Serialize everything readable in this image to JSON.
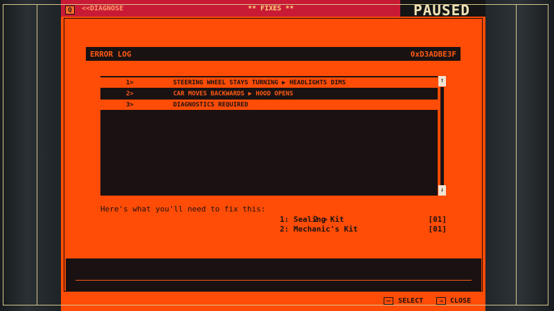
{
  "topbar": {
    "diagnose_label": "<<DIAGNOSE",
    "title": "** FIXES **",
    "q_key": "Q"
  },
  "status": {
    "paused": "PAUSED"
  },
  "error_log": {
    "title": "ERROR LOG",
    "code": "0xD3ADBE3F",
    "rows": [
      {
        "num": "1>",
        "text": "STEERING WHEEL STAYS TURNING ▶ HEADLIGHTS DIMS",
        "selected": true
      },
      {
        "num": "2>",
        "text": "CAR MOVES BACKWARDS ▶ HOOD OPENS",
        "selected": false
      },
      {
        "num": "3>",
        "text": "DIAGNOSTICS REQUIRED",
        "selected": true
      }
    ],
    "scroll_up": "↑",
    "scroll_down": "↓"
  },
  "fix": {
    "intro": "Here's what you'll need to fix this:",
    "prompt": "2 >",
    "parts": [
      {
        "name": "1: Sealing Kit",
        "qty": "[01]"
      },
      {
        "name": "2: Mechanic's Kit",
        "qty": "[01]"
      }
    ]
  },
  "footer": {
    "select_label": "SELECT",
    "close_label": "CLOSE",
    "close_icon": "⇥"
  },
  "colors": {
    "screen_orange": "#ff4c06",
    "dark": "#1a1212",
    "topbar_red": "#c91a35",
    "paused_cream": "#efe3b6"
  }
}
